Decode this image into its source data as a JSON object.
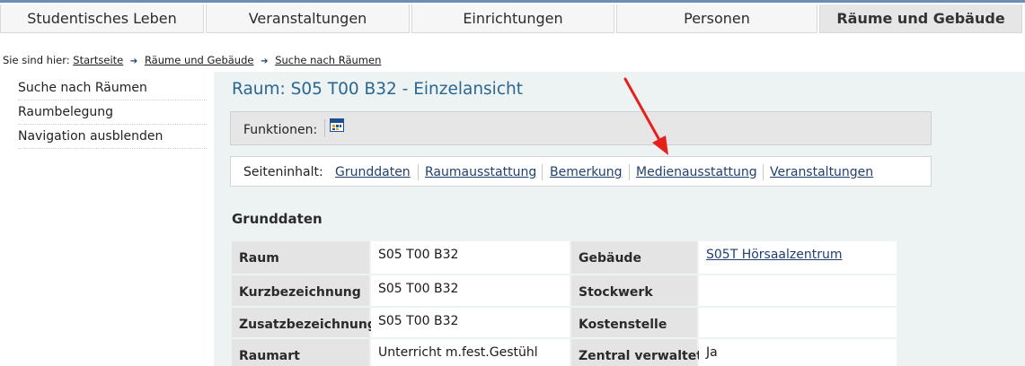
{
  "nav": {
    "tabs": [
      {
        "label": "Studentisches Leben"
      },
      {
        "label": "Veranstaltungen"
      },
      {
        "label": "Einrichtungen"
      },
      {
        "label": "Personen"
      },
      {
        "label": "Räume und Gebäude",
        "active": true
      }
    ]
  },
  "breadcrumb": {
    "prefix": "Sie sind hier:",
    "items": [
      "Startseite",
      "Räume und Gebäude",
      "Suche nach Räumen"
    ]
  },
  "sidebar": {
    "items": [
      {
        "label": "Suche nach Räumen"
      },
      {
        "label": "Raumbelegung"
      },
      {
        "label": "Navigation ausblenden"
      }
    ]
  },
  "main": {
    "title": "Raum: S05 T00 B32 - Einzelansicht",
    "functions_label": "Funktionen:",
    "functions_icon": "calendar-icon",
    "page_content_label": "Seiteninhalt:",
    "page_links": [
      "Grunddaten",
      "Raumausstattung",
      "Bemerkung",
      "Medienausstattung",
      "Veranstaltungen"
    ],
    "section_title": "Grunddaten",
    "rows": [
      {
        "label": "Raum",
        "value": "S05 T00 B32",
        "label2": "Gebäude",
        "value2": "S05T Hörsaalzentrum"
      },
      {
        "label": "Kurzbezeichnung",
        "value": "S05 T00 B32",
        "label2": "Stockwerk",
        "value2": ""
      },
      {
        "label": "Zusatzbezeichnung",
        "value": "S05 T00 B32",
        "label2": "Kostenstelle",
        "value2": ""
      },
      {
        "label": "Raumart",
        "value": "Unterricht m.fest.Gestühl",
        "label2": "Zentral verwaltet",
        "value2": "Ja"
      }
    ]
  },
  "annotation": {
    "type": "red-arrow",
    "color": "#e8201c",
    "target": "Medienausstattung"
  },
  "colors": {
    "accent": "#2a6692",
    "link": "#1f3f6f",
    "content_bg": "#edf3f2",
    "label_bg": "#e4e4e4"
  }
}
